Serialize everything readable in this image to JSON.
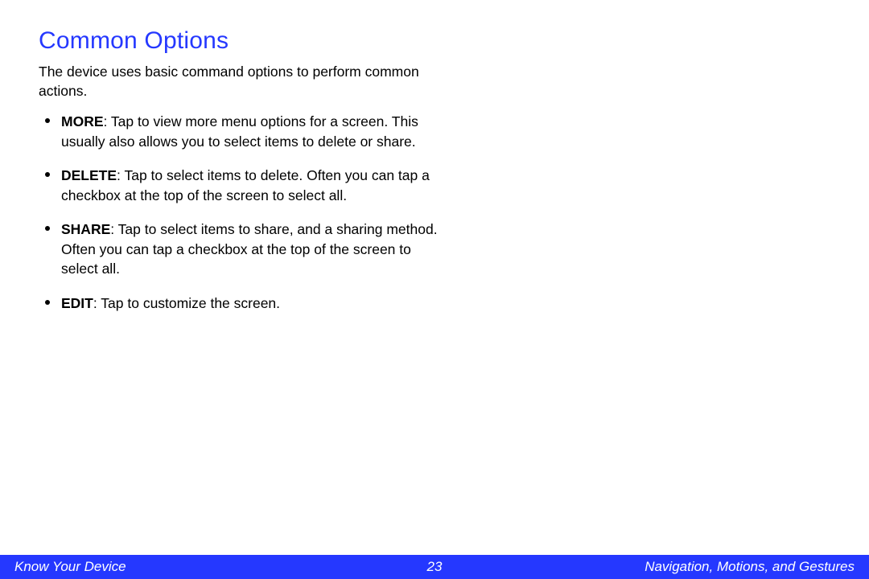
{
  "heading": "Common Options",
  "intro": "The device uses basic command options to perform common actions.",
  "items": [
    {
      "term": "MORE",
      "desc": ": Tap to view more menu options for a screen. This usually also allows you to select items to delete or share."
    },
    {
      "term": "DELETE",
      "desc": ": Tap to select items to delete. Often you can tap a checkbox at the top of the screen to select all."
    },
    {
      "term": "SHARE",
      "desc": ": Tap to select items to share, and a sharing method. Often you can tap a checkbox at the top of the screen to select all."
    },
    {
      "term": "EDIT",
      "desc": ": Tap to customize the screen."
    }
  ],
  "footer": {
    "left": "Know Your Device",
    "center": "23",
    "right": "Navigation, Motions, and Gestures"
  }
}
